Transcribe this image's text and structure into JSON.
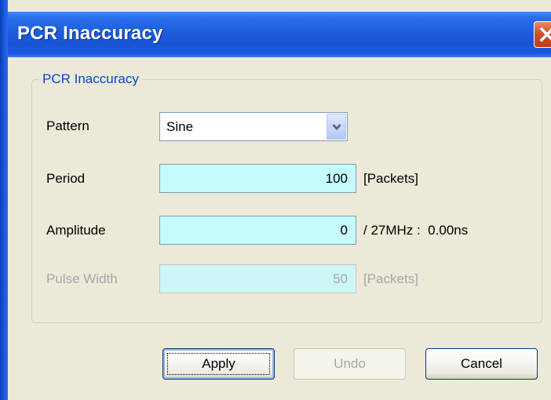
{
  "window": {
    "title": "PCR Inaccuracy",
    "close_icon": "close-icon"
  },
  "group": {
    "legend": "PCR Inaccuracy"
  },
  "fields": {
    "pattern": {
      "label": "Pattern",
      "value": "Sine"
    },
    "period": {
      "label": "Period",
      "value": "100",
      "unit": "[Packets]"
    },
    "amplitude": {
      "label": "Amplitude",
      "value": "0",
      "unit": "/ 27MHz :  0.00ns"
    },
    "pulse_width": {
      "label": "Pulse Width",
      "value": "50",
      "unit": "[Packets]"
    }
  },
  "buttons": {
    "apply": "Apply",
    "undo": "Undo",
    "cancel": "Cancel"
  },
  "colors": {
    "titlebar": "#1f5fe0",
    "field_background": "#c5fbfd",
    "legend_text": "#0046d5",
    "disabled_text": "#a7a6aa",
    "close_button": "#d2502c"
  }
}
